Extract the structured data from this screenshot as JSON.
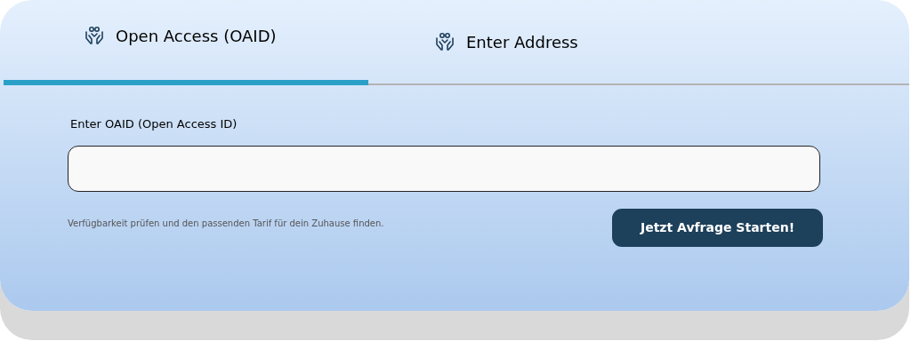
{
  "tabs": [
    {
      "label": "Open Access (OAID)",
      "selected": true
    },
    {
      "label": "Enter Address",
      "selected": false
    }
  ],
  "field": {
    "label": "Enter OAID (Open Access ID)"
  },
  "hint": "Verfügbarkeit prüfen und den passenden Tarif für dein Zuhause finden.",
  "submit_button": "Jetzt Avfrage Starten!"
}
